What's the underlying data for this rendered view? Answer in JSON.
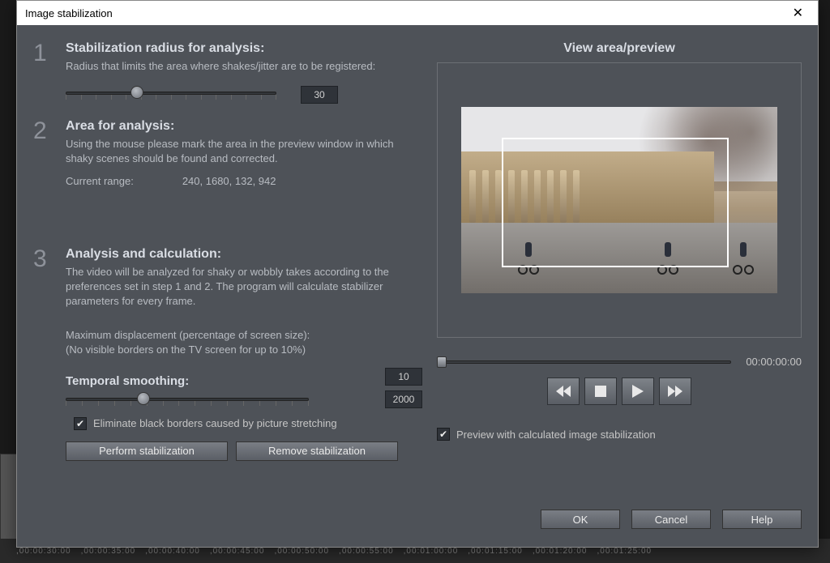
{
  "dialog": {
    "title": "Image stabilization",
    "step1": {
      "heading": "Stabilization radius for analysis:",
      "desc": "Radius that limits the area where shakes/jitter are to be registered:",
      "value": "30"
    },
    "step2": {
      "heading": "Area for analysis:",
      "desc": "Using the mouse please mark the area in the preview window in which shaky scenes should be found and corrected.",
      "range_label": "Current range:",
      "range_value": "240, 1680, 132, 942"
    },
    "step3": {
      "heading": "Analysis and calculation:",
      "desc": "The video will be analyzed for shaky or wobbly takes according to the preferences set in step 1 and 2. The program will calculate stabilizer parameters for every frame.",
      "maxdisp_line1": "Maximum displacement (percentage of screen size):",
      "maxdisp_line2": "(No visible borders on the TV screen for up to 10%)",
      "maxdisp_value": "10",
      "temporal_heading": "Temporal smoothing:",
      "temporal_value": "2000",
      "eliminate_borders_label": "Eliminate black borders caused by picture stretching",
      "perform_btn": "Perform stabilization",
      "remove_btn": "Remove stabilization"
    },
    "preview": {
      "heading": "View area/preview",
      "timecode": "00:00:00:00",
      "preview_checkbox": "Preview with calculated image stabilization"
    },
    "buttons": {
      "ok": "OK",
      "cancel": "Cancel",
      "help": "Help"
    }
  },
  "timeline": {
    "t0": ",00:00:30:00",
    "t1": ",00:00:35:00",
    "t2": ",00:00:40:00",
    "t3": ",00:00:45:00",
    "t4": ",00:00:50:00",
    "t5": ",00:00:55:00",
    "t6": ",00:01:00:00",
    "t7": ",00:01:15:00",
    "t8": ",00:01:20:00",
    "t9": ",00:01:25:00"
  }
}
